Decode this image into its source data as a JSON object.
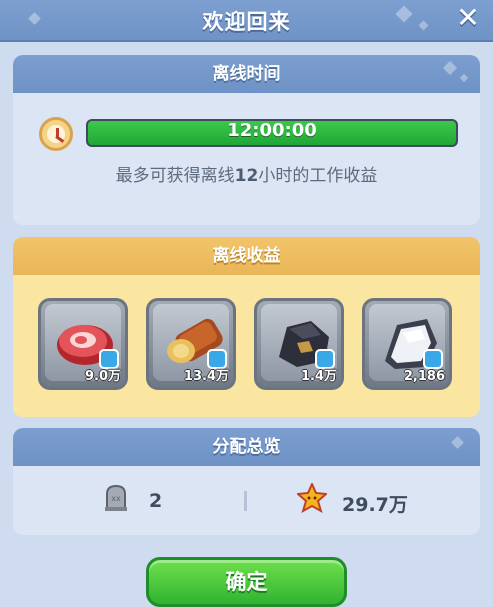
{
  "header": {
    "title": "欢迎回来",
    "close_icon": "close-icon"
  },
  "offline_time": {
    "title": "离线时间",
    "icon": "clock-icon",
    "timer": "12:00:00",
    "progress": 1.0,
    "note_prefix": "最多可获得离线",
    "note_hours": "12",
    "note_suffix": "小时的工作收益"
  },
  "offline_income": {
    "title": "离线收益",
    "resources": [
      {
        "icon": "meat-icon",
        "amount": "9.0万"
      },
      {
        "icon": "wood-log-icon",
        "amount": "13.4万"
      },
      {
        "icon": "coal-ore-icon",
        "amount": "1.4万"
      },
      {
        "icon": "stone-icon",
        "amount": "2,186"
      }
    ]
  },
  "allocation": {
    "title": "分配总览",
    "tombstone_icon": "tombstone-icon",
    "tombstone_count": "2",
    "star_icon": "star-icon",
    "star_value": "29.7万"
  },
  "confirm": {
    "label": "确定"
  },
  "colors": {
    "header": "#7597c9",
    "progress": "#2bb53e",
    "income_panel": "#fae5a1",
    "button": "#3cc13a"
  }
}
